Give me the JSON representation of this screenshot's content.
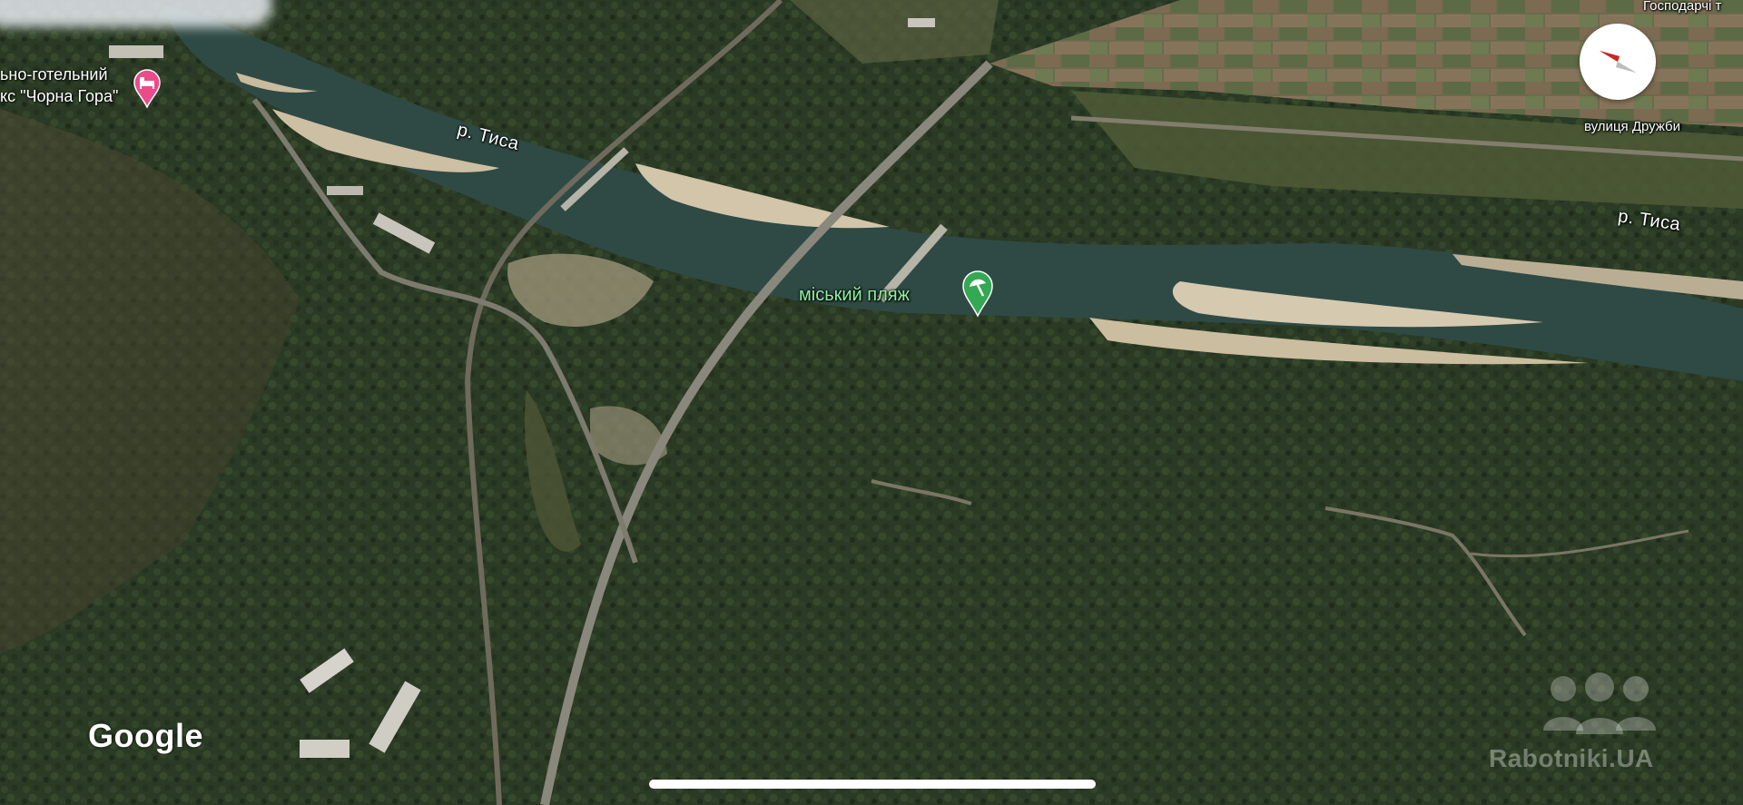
{
  "map": {
    "type": "satellite-3d",
    "colors": {
      "forest": "#2b3b25",
      "river": "#2f4a45",
      "sand": "#cdbfa3",
      "road": "#8a877d",
      "poi_green": "#34a853",
      "poi_pink": "#ea4c89"
    }
  },
  "labels": {
    "river_top": "р. Тиса",
    "river_right": "р. Тиса",
    "street_top_right": "Господарчі т",
    "street_druzhby": "вулиця Дружби",
    "beach": "міський пляж",
    "hotel_line1": "ьно-готельний",
    "hotel_line2": "кс \"Чорна Гора\""
  },
  "icons": {
    "beach_pin": "beach-umbrella-pin-icon",
    "hotel_pin": "hotel-bed-pin-icon",
    "compass": "compass-icon"
  },
  "branding": {
    "google": "Google",
    "watermark": "Rabotniki.UA"
  }
}
